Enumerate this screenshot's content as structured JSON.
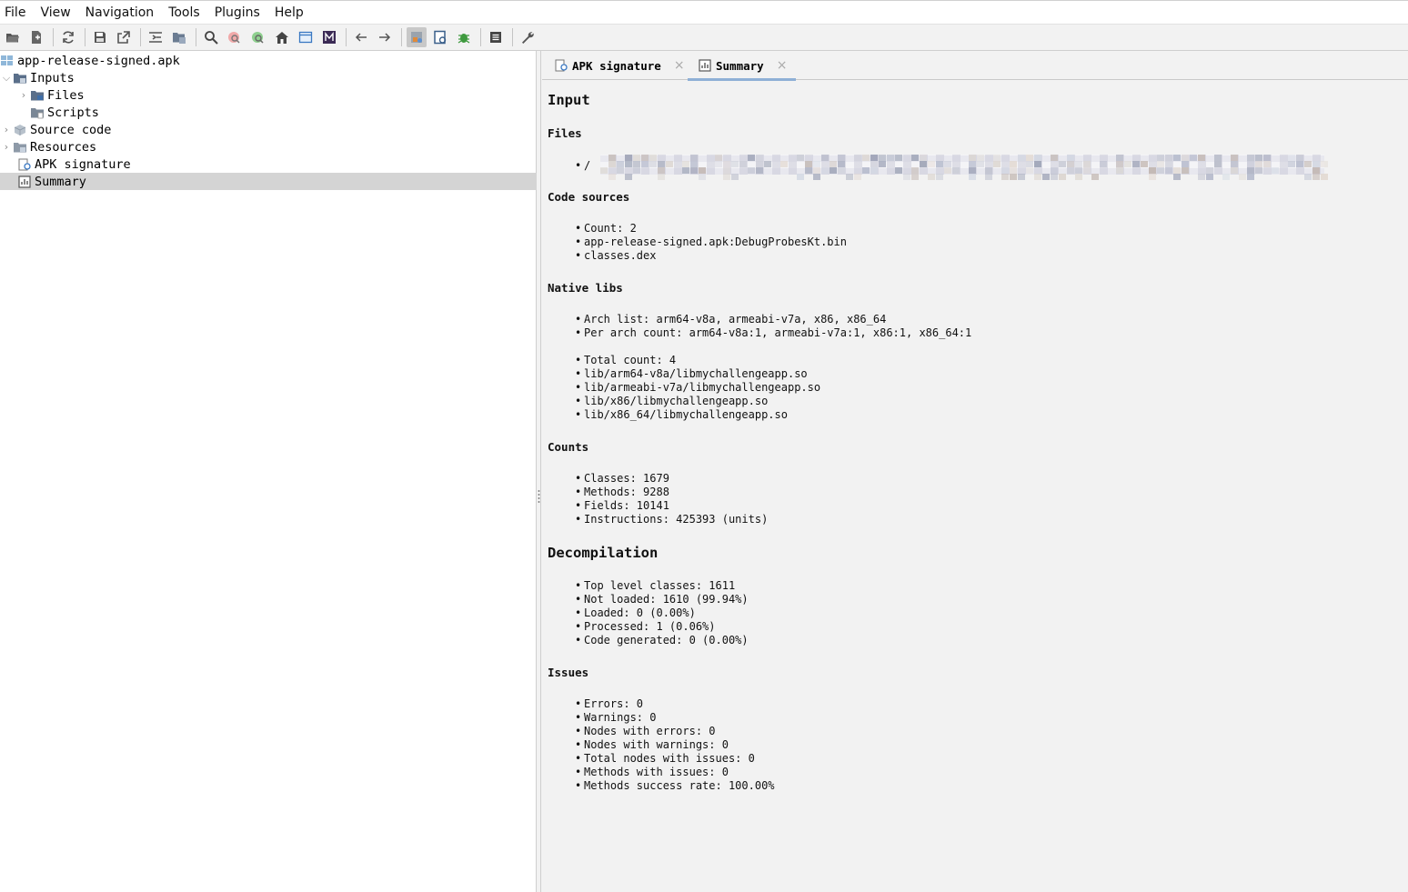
{
  "menu": [
    "File",
    "View",
    "Navigation",
    "Tools",
    "Plugins",
    "Help"
  ],
  "toolbar": {
    "icons": [
      "open-file-icon",
      "add-files-icon",
      "sync-icon",
      "save-icon",
      "export-icon",
      "sync-tree-icon",
      "flatten-packages-icon",
      "search-icon",
      "find-usage-icon",
      "search-class-icon",
      "home-icon",
      "log-viewer-icon",
      "smali-icon",
      "back-icon",
      "forward-icon",
      "quark-icon",
      "preview-icon",
      "debugger-icon",
      "log-icon",
      "preferences-icon"
    ]
  },
  "tree": {
    "root": "app-release-signed.apk",
    "inputs": "Inputs",
    "files": "Files",
    "scripts": "Scripts",
    "source_code": "Source code",
    "resources": "Resources",
    "apk_signature": "APK signature",
    "summary": "Summary"
  },
  "tabs": [
    {
      "label": "APK signature",
      "close": "×"
    },
    {
      "label": "Summary",
      "close": "×"
    }
  ],
  "summary": {
    "input_title": "Input",
    "files_title": "Files",
    "files_path_prefix": "/",
    "code_sources_title": "Code sources",
    "code_sources": [
      "Count: 2",
      "app-release-signed.apk:DebugProbesKt.bin",
      "classes.dex"
    ],
    "native_libs_title": "Native libs",
    "native_arch": [
      "Arch list: arm64-v8a, armeabi-v7a, x86, x86_64",
      "Per arch count: arm64-v8a:1, armeabi-v7a:1, x86:1, x86_64:1"
    ],
    "native_files": [
      "Total count: 4",
      "lib/arm64-v8a/libmychallengeapp.so",
      "lib/armeabi-v7a/libmychallengeapp.so",
      "lib/x86/libmychallengeapp.so",
      "lib/x86_64/libmychallengeapp.so"
    ],
    "counts_title": "Counts",
    "counts": [
      "Classes: 1679",
      "Methods: 9288",
      "Fields: 10141",
      "Instructions: 425393 (units)"
    ],
    "decompilation_title": "Decompilation",
    "decompilation": [
      "Top level classes: 1611",
      "Not loaded: 1610 (99.94%)",
      "Loaded: 0 (0.00%)",
      "Processed: 1 (0.06%)",
      "Code generated: 0 (0.00%)"
    ],
    "issues_title": "Issues",
    "issues": [
      "Errors: 0",
      "Warnings: 0",
      "Nodes with errors: 0",
      "Nodes with warnings: 0",
      "Total nodes with issues: 0",
      "Methods with issues: 0",
      "Methods success rate: 100.00%"
    ]
  },
  "colors": {
    "tab_underline": "#8fb0d6",
    "selection": "#d4d4d4",
    "folder": "#5a6f8a"
  }
}
